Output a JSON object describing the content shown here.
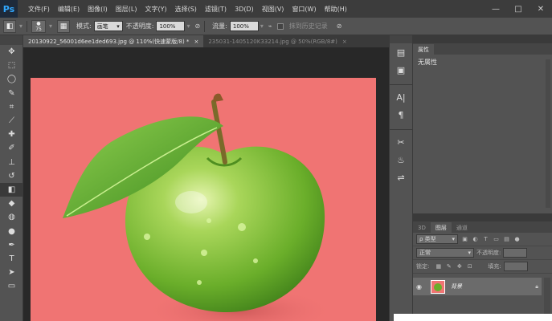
{
  "app": {
    "logo": "Ps"
  },
  "menu": [
    "文件(F)",
    "编辑(E)",
    "图像(I)",
    "图层(L)",
    "文字(Y)",
    "选择(S)",
    "滤镜(T)",
    "3D(D)",
    "视图(V)",
    "窗口(W)",
    "帮助(H)"
  ],
  "window_controls": [
    "—",
    "□",
    "✕"
  ],
  "options": {
    "brush_size": "75",
    "mode_label": "模式:",
    "mode_value": "画笔",
    "opacity_label": "不透明度:",
    "opacity_value": "100%",
    "flow_label": "流量:",
    "flow_value": "100%",
    "history_label": "抹到历史记录"
  },
  "tabs": [
    {
      "label": "20130922_56001d6ee1ded693.jpg @ 110%(快速蒙版/8) *",
      "close": "×"
    },
    {
      "label": "235031-1405120K33214.jpg @ 50%(RGB/8#)",
      "close": "×"
    }
  ],
  "tools": [
    {
      "icon": "move-icon",
      "glyph": "✥"
    },
    {
      "icon": "marquee-icon",
      "glyph": "⬚"
    },
    {
      "icon": "lasso-icon",
      "glyph": "◯"
    },
    {
      "icon": "quick-select-icon",
      "glyph": "✎"
    },
    {
      "icon": "crop-icon",
      "glyph": "⌗"
    },
    {
      "icon": "eyedropper-icon",
      "glyph": "⟋"
    },
    {
      "icon": "healing-icon",
      "glyph": "✚"
    },
    {
      "icon": "brush-icon",
      "glyph": "✐"
    },
    {
      "icon": "stamp-icon",
      "glyph": "⊥"
    },
    {
      "icon": "history-brush-icon",
      "glyph": "↺"
    },
    {
      "icon": "eraser-icon",
      "glyph": "◧"
    },
    {
      "icon": "paint-bucket-icon",
      "glyph": "◆"
    },
    {
      "icon": "blur-icon",
      "glyph": "◍"
    },
    {
      "icon": "dodge-icon",
      "glyph": "●"
    },
    {
      "icon": "pen-icon",
      "glyph": "✒"
    },
    {
      "icon": "type-icon",
      "glyph": "T"
    },
    {
      "icon": "path-select-icon",
      "glyph": "➤"
    },
    {
      "icon": "shape-icon",
      "glyph": "▭"
    }
  ],
  "strip_icons": [
    {
      "icon": "history-panel-icon",
      "glyph": "▤"
    },
    {
      "icon": "actions-panel-icon",
      "glyph": "▣"
    },
    {
      "icon": "character-panel-icon",
      "glyph": "A|"
    },
    {
      "icon": "paragraph-panel-icon",
      "glyph": "¶"
    },
    {
      "icon": "tools-preset-icon",
      "glyph": "✂"
    },
    {
      "icon": "brush-preset-icon",
      "glyph": "♨"
    },
    {
      "icon": "adjust-icon",
      "glyph": "⇌"
    }
  ],
  "properties": {
    "tab": "属性",
    "none": "无属性"
  },
  "layers": {
    "tabs": [
      "3D",
      "图层",
      "通道"
    ],
    "filter_label": "ρ 类型",
    "blend_mode": "正常",
    "opacity_label": "不透明度:",
    "lock_label": "锁定:",
    "fill_label": "填充:",
    "layer_name": "背景"
  },
  "colors": {
    "canvas_bg": "#f07473",
    "ui_bg": "#535353",
    "menubar": "#3c3c3c",
    "accent": "#31a8ff"
  }
}
